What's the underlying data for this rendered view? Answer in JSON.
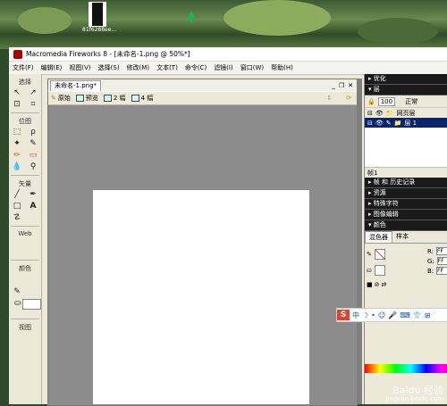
{
  "desktop": {
    "file_label": "81f6288ee..."
  },
  "window": {
    "title": "Macromedia Fireworks 8 - [未命名-1.png @  50%*]"
  },
  "menu": [
    "文件(F)",
    "编辑(E)",
    "视图(V)",
    "选择(S)",
    "修改(M)",
    "文本(T)",
    "命令(C)",
    "滤镜(I)",
    "窗口(W)",
    "帮助(H)"
  ],
  "tools": {
    "select_label": "选择",
    "bitmap_label": "位图",
    "vector_label": "矢量",
    "web_label": "Web",
    "colors_label": "颜色",
    "view_label": "视图"
  },
  "document": {
    "tab_label": "未命名-1.png*",
    "views": {
      "original": "原始",
      "preview": "预览",
      "two_up": "2 幅",
      "four_up": "4 幅"
    }
  },
  "panels": {
    "optimize": "▸ 优化",
    "layers": "▾ 层",
    "opacity": "100",
    "blend": "正常",
    "web_layer": "网页层",
    "layer1": "层 1",
    "frame": "帧1",
    "frames_history": "▸ 帧 和 历史记录",
    "assets": "▸ 资源",
    "special_chars": "▸ 特殊字符",
    "image_editing": "▸ 图像编辑",
    "colors": "▾ 颜色",
    "mixer_tab": "混色器",
    "swatches_tab": "样本",
    "r_label": "R:",
    "g_label": "G:",
    "b_label": "B:",
    "r_val": "FF",
    "g_val": "FF",
    "b_val": "FF"
  },
  "ime": {
    "logo": "S",
    "chinese": "中"
  },
  "watermark": {
    "site": "Baidu 经验",
    "url": "jingyan.baidu.com"
  }
}
